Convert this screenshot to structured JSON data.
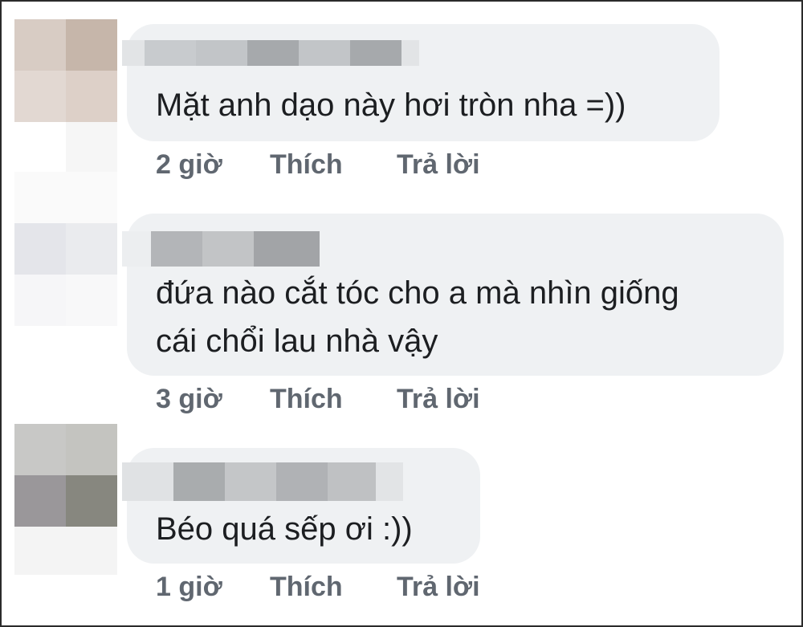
{
  "comments": [
    {
      "text": [
        "Mặt anh dạo này hơi tròn nha =))"
      ],
      "time": "2 giờ",
      "like": "Thích",
      "reply": "Trả lời"
    },
    {
      "text": [
        "đứa nào cắt tóc cho a mà nhìn giống",
        "cái chổi lau nhà vậy"
      ],
      "time": "3 giờ",
      "like": "Thích",
      "reply": "Trả lời"
    },
    {
      "text": [
        "Béo quá sếp ơi :))"
      ],
      "time": "1 giờ",
      "like": "Thích",
      "reply": "Trả lời"
    }
  ],
  "colors": {
    "bubble": "#eff1f3",
    "comment_text": "#1c1e21",
    "action_text": "#606770",
    "border": "#2b2b2b"
  }
}
